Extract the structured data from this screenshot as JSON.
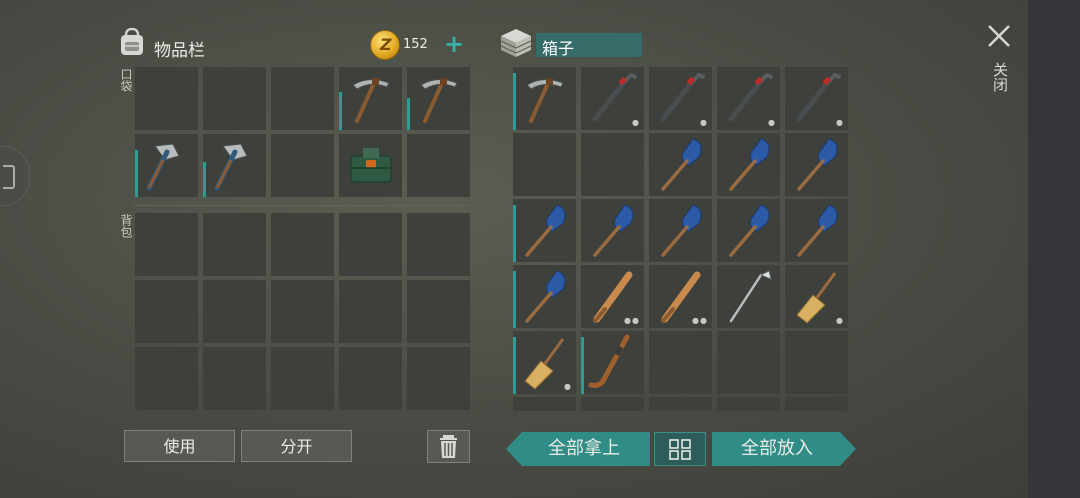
{
  "inventory": {
    "title": "物品栏",
    "coin_count": "152",
    "pocket_label": "口袋",
    "backpack_label": "背包",
    "pocket_slots": [
      {
        "item": "",
        "dur": 0,
        "dots": ""
      },
      {
        "item": "",
        "dur": 0,
        "dots": ""
      },
      {
        "item": "",
        "dur": 0,
        "dots": ""
      },
      {
        "item": "pickaxe",
        "dur": 0.6,
        "dots": ""
      },
      {
        "item": "pickaxe",
        "dur": 0.5,
        "dots": ""
      },
      {
        "item": "hatchet",
        "dur": 0.75,
        "dots": ""
      },
      {
        "item": "hatchet",
        "dur": 0.55,
        "dots": ""
      },
      {
        "item": "",
        "dur": 0,
        "dots": ""
      },
      {
        "item": "first-aid-bag",
        "dur": 0,
        "dots": ""
      },
      {
        "item": "",
        "dur": 0,
        "dots": ""
      }
    ],
    "backpack_slot_count": 15,
    "use_label": "使用",
    "split_label": "分开"
  },
  "box": {
    "title": "箱子",
    "slots": [
      {
        "item": "pickaxe",
        "dur": 0.9,
        "dots": ""
      },
      {
        "item": "crowbar",
        "dur": 0,
        "dots": "●"
      },
      {
        "item": "crowbar",
        "dur": 0,
        "dots": "●"
      },
      {
        "item": "crowbar",
        "dur": 0,
        "dots": "●"
      },
      {
        "item": "crowbar",
        "dur": 0,
        "dots": "●"
      },
      {
        "item": "",
        "dur": 0,
        "dots": ""
      },
      {
        "item": "",
        "dur": 0,
        "dots": ""
      },
      {
        "item": "paddle",
        "dur": 0,
        "dots": ""
      },
      {
        "item": "paddle",
        "dur": 0,
        "dots": ""
      },
      {
        "item": "paddle",
        "dur": 0,
        "dots": ""
      },
      {
        "item": "paddle",
        "dur": 0.9,
        "dots": ""
      },
      {
        "item": "paddle",
        "dur": 0,
        "dots": ""
      },
      {
        "item": "paddle",
        "dur": 0,
        "dots": ""
      },
      {
        "item": "paddle",
        "dur": 0,
        "dots": ""
      },
      {
        "item": "paddle",
        "dur": 0,
        "dots": ""
      },
      {
        "item": "paddle",
        "dur": 0.9,
        "dots": ""
      },
      {
        "item": "bat",
        "dur": 0,
        "dots": "●●"
      },
      {
        "item": "bat",
        "dur": 0,
        "dots": "●●"
      },
      {
        "item": "golf-club",
        "dur": 0,
        "dots": ""
      },
      {
        "item": "broom",
        "dur": 0,
        "dots": "●"
      },
      {
        "item": "broom",
        "dur": 0.9,
        "dots": "●"
      },
      {
        "item": "hockey-stick",
        "dur": 0.9,
        "dots": ""
      },
      {
        "item": "",
        "dur": 0,
        "dots": ""
      },
      {
        "item": "",
        "dur": 0,
        "dots": ""
      },
      {
        "item": "",
        "dur": 0,
        "dots": ""
      }
    ],
    "take_all_label": "全部拿上",
    "put_all_label": "全部放入"
  },
  "close_label": "关闭",
  "colors": {
    "accent": "#2f8c86",
    "durability": "#2f9c93",
    "coin": "#e0a51f",
    "plus": "#35b3a8"
  }
}
